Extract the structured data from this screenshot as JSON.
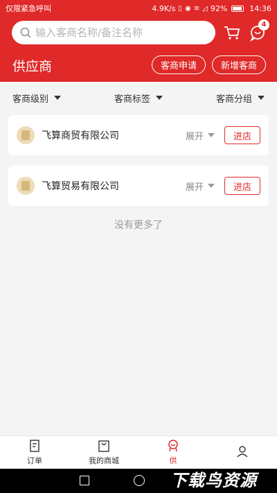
{
  "status_bar": {
    "left_text": "仅限紧急呼叫",
    "speed": "4.9K/s",
    "battery": "92%",
    "time": "14:36"
  },
  "search": {
    "placeholder": "输入客商名称/备注名称"
  },
  "header": {
    "title": "供应商",
    "apply_label": "客商申请",
    "add_label": "新增客商",
    "message_badge": "4"
  },
  "filters": [
    {
      "label": "客商级别"
    },
    {
      "label": "客商标签"
    },
    {
      "label": "客商分组"
    }
  ],
  "suppliers": [
    {
      "name": "飞算商贸有限公司",
      "expand_label": "展开",
      "enter_label": "进店"
    },
    {
      "name": "飞算贸易有限公司",
      "expand_label": "展开",
      "enter_label": "进店"
    }
  ],
  "list_footer": "没有更多了",
  "tabbar": {
    "tabs": [
      {
        "label": "订单",
        "icon": "order-icon"
      },
      {
        "label": "我的商城",
        "icon": "shopping-bag-icon"
      },
      {
        "label": "供",
        "icon": "supplier-badge-icon",
        "active": true
      },
      {
        "label": "",
        "icon": "user-icon"
      }
    ]
  },
  "watermark": "下载鸟资源",
  "colors": {
    "brand_red": "#e02929",
    "background": "#f4f4f4"
  }
}
